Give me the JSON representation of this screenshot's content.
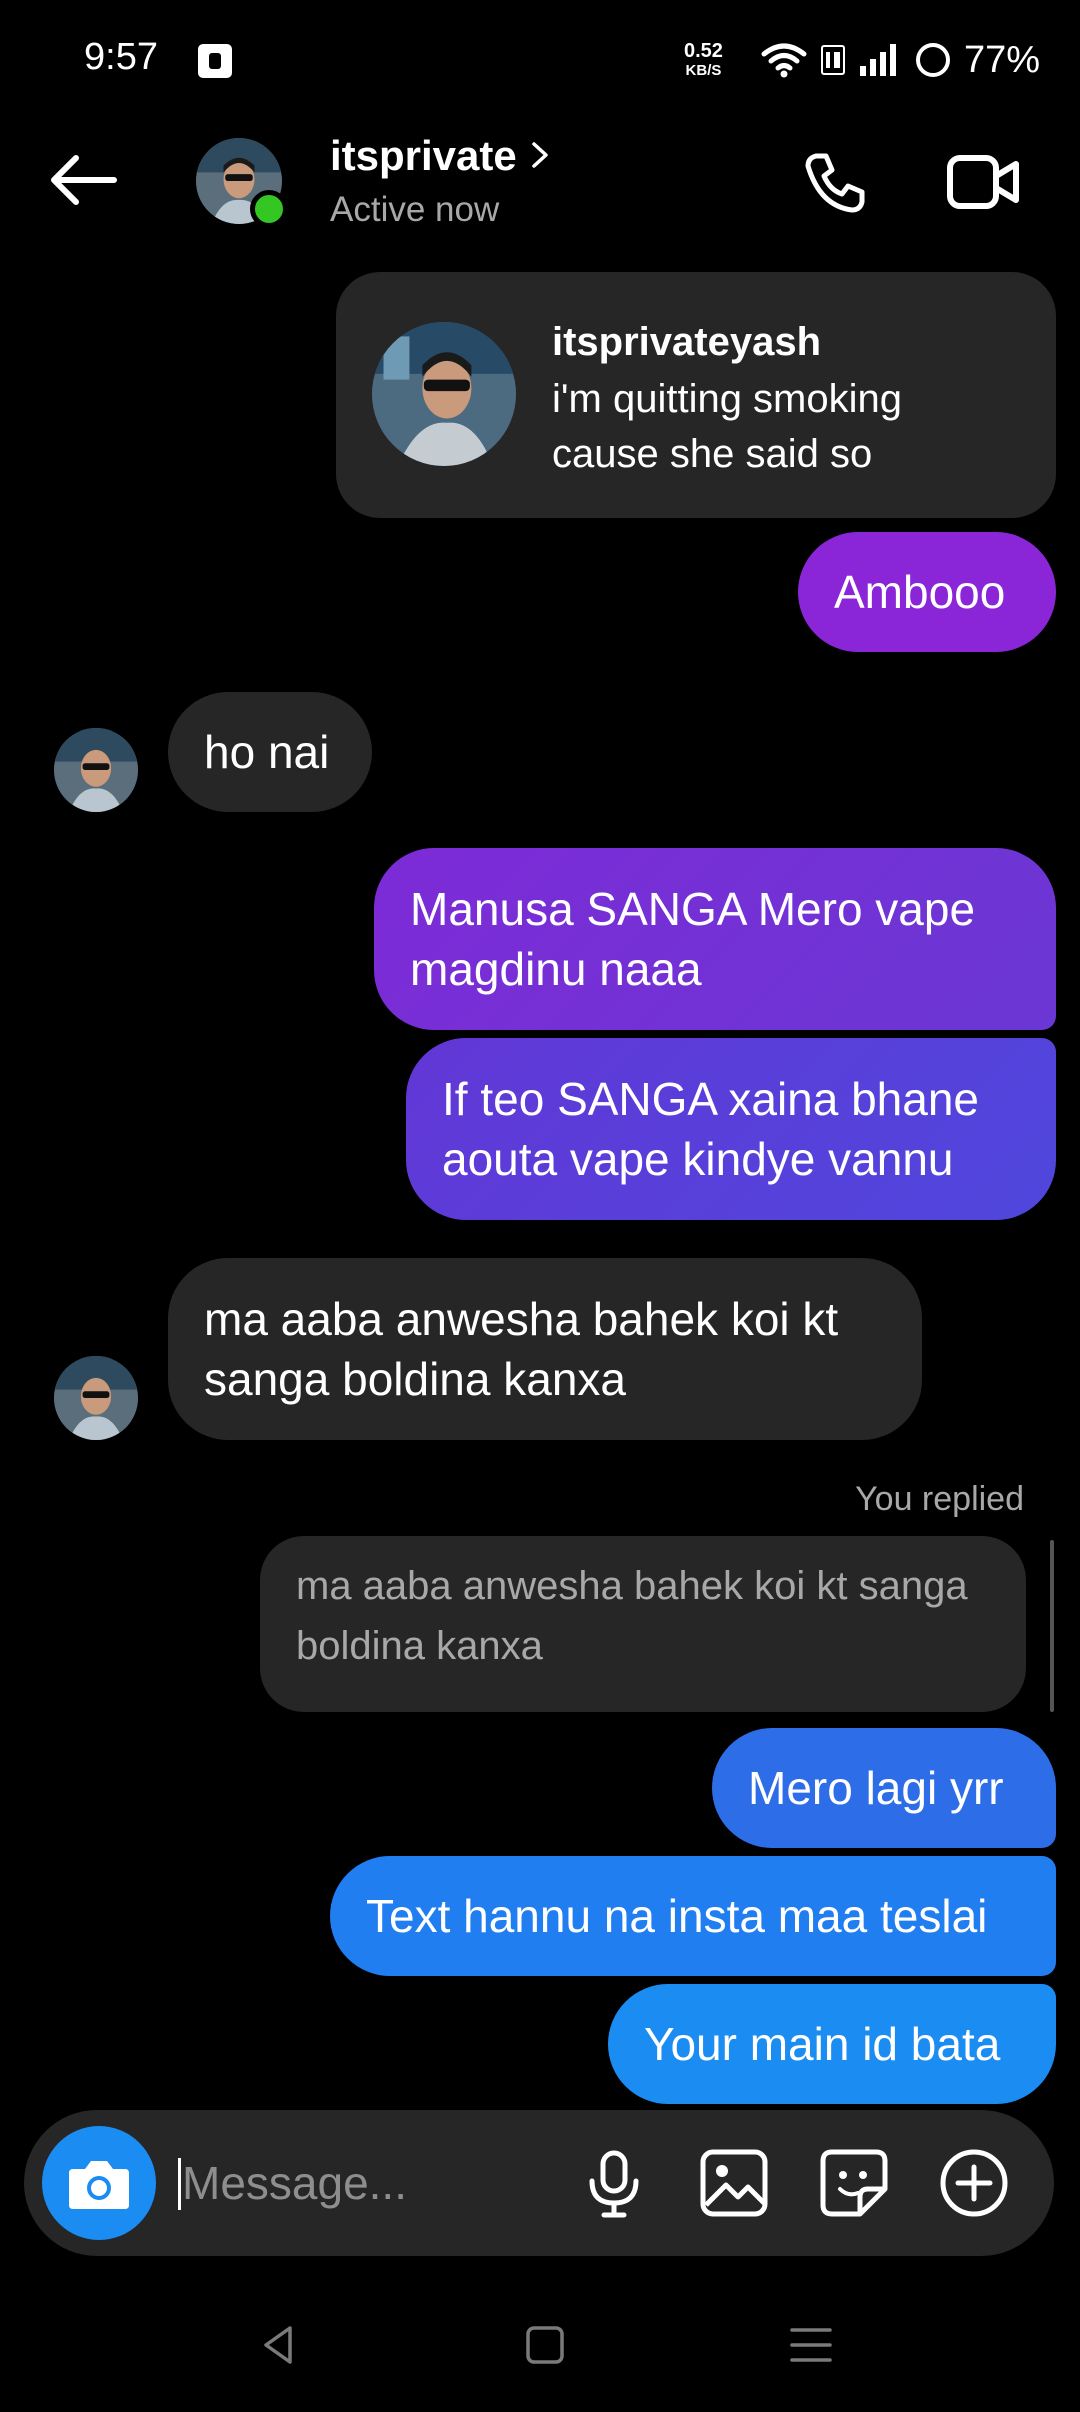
{
  "status_bar": {
    "time": "9:57",
    "net_speed_value": "0.52",
    "net_speed_unit": "KB/S",
    "battery": "77%"
  },
  "header": {
    "name": "itsprivate",
    "status": "Active now"
  },
  "shared_post": {
    "username": "itsprivateyash",
    "caption": "i'm quitting smoking cause she said so"
  },
  "messages": {
    "m1": "Ambooo",
    "m2": "ho nai",
    "m3": "Manusa SANGA Mero vape magdinu naaa",
    "m4": "If teo SANGA xaina bhane aouta vape kindye vannu",
    "m5": "ma aaba anwesha bahek koi kt sanga boldina kanxa",
    "reply_label": "You replied",
    "reply_quote": "ma aaba anwesha bahek koi kt sanga boldina kanxa",
    "m6": "Mero lagi yrr",
    "m7": "Text hannu na insta maa teslai",
    "m8": "Your main id bata"
  },
  "composer": {
    "placeholder": "Message..."
  },
  "icons": {
    "back": "arrow-left-icon",
    "call": "phone-icon",
    "video": "video-camera-icon",
    "camera": "camera-icon",
    "mic": "microphone-icon",
    "gallery": "image-icon",
    "sticker": "sticker-icon",
    "more": "plus-circle-icon"
  },
  "colors": {
    "purple_1": "#8a26d7",
    "purple_2": "#6b36d3",
    "indigo": "#5a43db",
    "blue_1": "#2d6ee8",
    "blue_2": "#1a8cf2",
    "incoming": "#262626",
    "online": "#34c724"
  }
}
